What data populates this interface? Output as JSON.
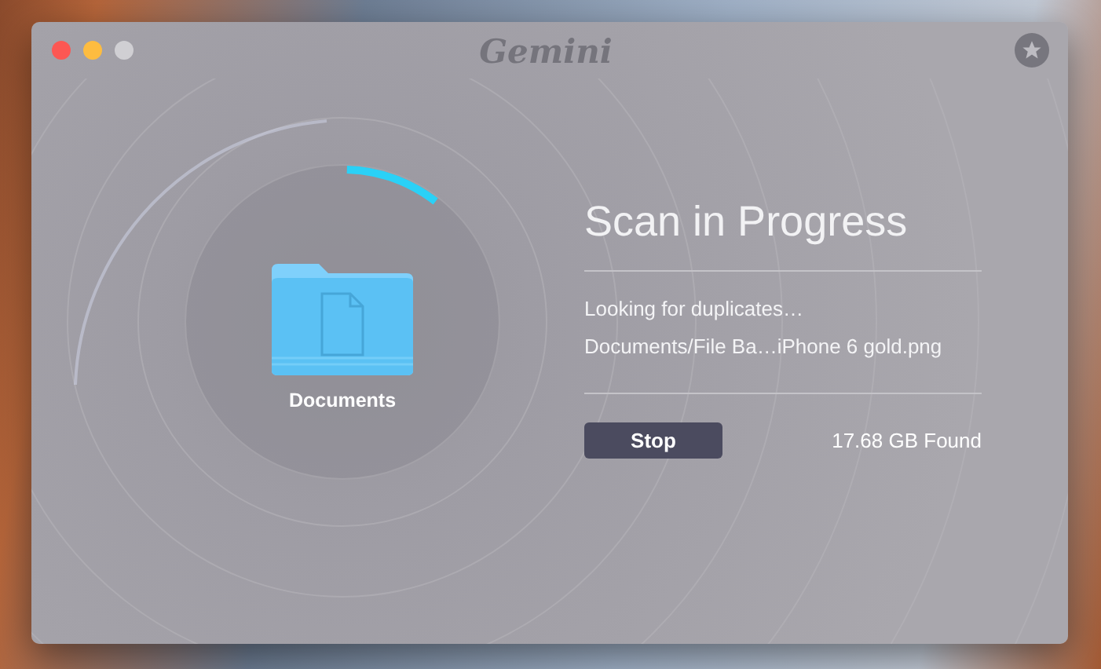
{
  "window": {
    "title": "Gemini"
  },
  "scan": {
    "folder_label": "Documents",
    "title": "Scan in Progress",
    "status": "Looking for duplicates…",
    "current_file": "Documents/File Ba…iPhone 6 gold.png",
    "stop_button": "Stop",
    "found": "17.68 GB Found"
  }
}
